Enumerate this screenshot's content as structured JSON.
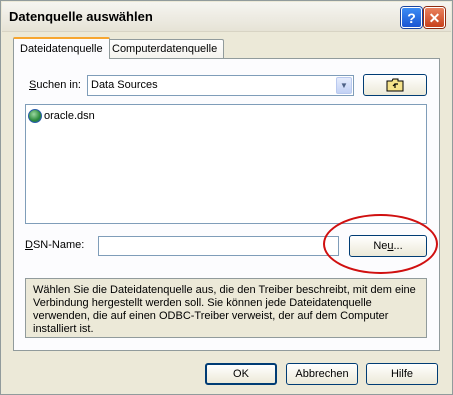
{
  "window": {
    "title": "Datenquelle auswählen",
    "help_label": "?",
    "close_label": "✕"
  },
  "tabs": [
    {
      "label": "Dateidatenquelle",
      "active": true
    },
    {
      "label": "Computerdatenquelle",
      "active": false
    }
  ],
  "look_in": {
    "label_prefix": "S",
    "label_rest": "uchen in:",
    "value": "Data Sources"
  },
  "files": [
    {
      "name": "oracle.dsn",
      "icon": "globe-icon"
    }
  ],
  "dsn": {
    "label_prefix": "D",
    "label_rest": "SN-Name:",
    "value": ""
  },
  "new_button": {
    "label_prefix": "Ne",
    "label_underlined": "u",
    "label_rest": "..."
  },
  "info_text": "Wählen Sie die Dateidatenquelle aus, die den Treiber beschreibt, mit dem eine Verbindung hergestellt werden soll. Sie können jede Dateidatenquelle verwenden, die auf einen ODBC-Treiber verweist, der auf dem Computer installiert ist.",
  "buttons": {
    "ok": "OK",
    "cancel": "Abbrechen",
    "help": "Hilfe"
  },
  "colors": {
    "annotation_circle": "#d01010",
    "active_tab_accent": "#f7a62f"
  }
}
